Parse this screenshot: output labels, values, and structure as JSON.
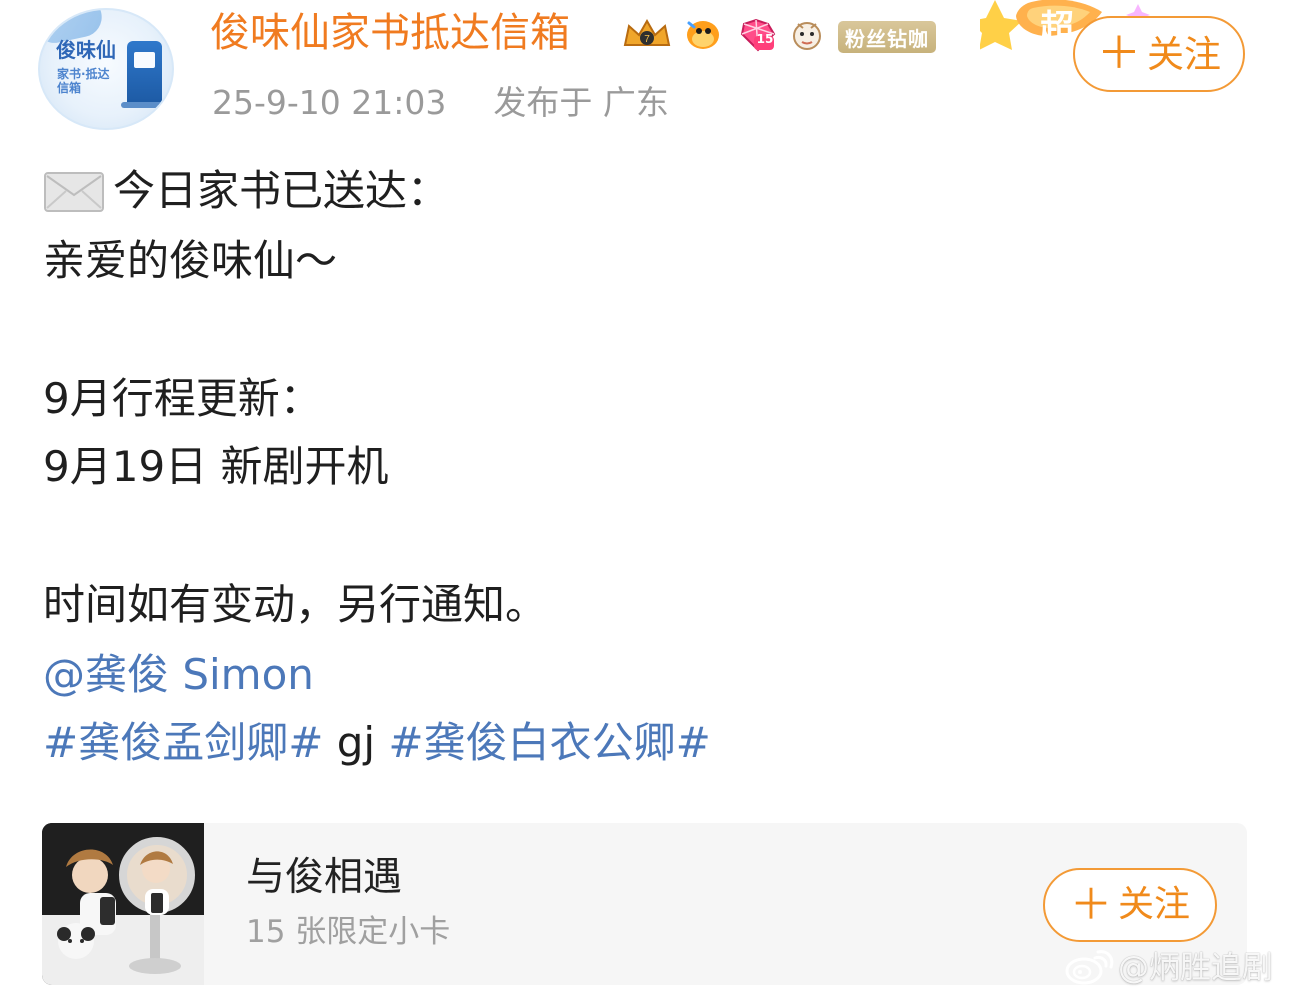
{
  "header": {
    "avatar": {
      "title": "俊味仙",
      "subtitle": "家书·抵达信箱"
    },
    "nickname": "俊味仙家书抵达信箱",
    "badges": {
      "crown": "crown-badge-icon",
      "fish": "fish-badge-icon",
      "gem_level": "15",
      "pet": "pet-badge-icon",
      "fan_tag": "粉丝钻咖"
    },
    "meta": {
      "time": "25-9-10 21:03",
      "location": "发布于 广东"
    },
    "decoration": {
      "super_text": "超"
    },
    "follow_label": "关注",
    "follow_plus": "＋"
  },
  "post": {
    "intro": "今日家书已送达：",
    "greeting": "亲爱的俊味仙～",
    "schedule_title": "9月行程更新：",
    "schedule_item": "9月19日 新剧开机",
    "notice": "时间如有变动，另行通知。",
    "mention": "@龚俊 Simon",
    "hashtag_1": "#龚俊孟剑卿#",
    "plain_text": " gj ",
    "hashtag_2": "#龚俊白衣公卿#"
  },
  "card": {
    "title": "与俊相遇",
    "subtitle": "15 张限定小卡",
    "follow_label": "关注",
    "follow_plus": "＋"
  },
  "watermark": {
    "text": "@炳胜追剧"
  },
  "colors": {
    "orange": "#f08a1b",
    "blue_link": "#4c78b9",
    "gray_text": "#9a9a9a",
    "card_bg": "#f6f6f6"
  }
}
